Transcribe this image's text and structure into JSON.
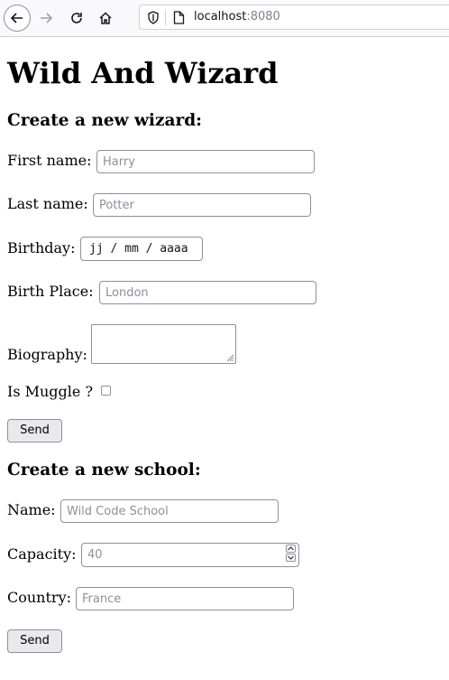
{
  "browser": {
    "url_host": "localhost",
    "url_port": ":8080"
  },
  "page": {
    "title": "Wild And Wizard"
  },
  "wizard_form": {
    "heading": "Create a new wizard:",
    "first_name_label": "First name:",
    "first_name_placeholder": "Harry",
    "last_name_label": "Last name:",
    "last_name_placeholder": "Potter",
    "birthday_label": "Birthday:",
    "birthday_value": "jj / mm / aaaa",
    "birth_place_label": "Birth Place:",
    "birth_place_placeholder": "London",
    "biography_label": "Biography:",
    "muggle_label": "Is Muggle ?",
    "send_label": "Send"
  },
  "school_form": {
    "heading": "Create a new school:",
    "name_label": "Name:",
    "name_placeholder": "Wild Code School",
    "capacity_label": "Capacity:",
    "capacity_placeholder": "40",
    "country_label": "Country:",
    "country_placeholder": "France",
    "send_label": "Send"
  }
}
